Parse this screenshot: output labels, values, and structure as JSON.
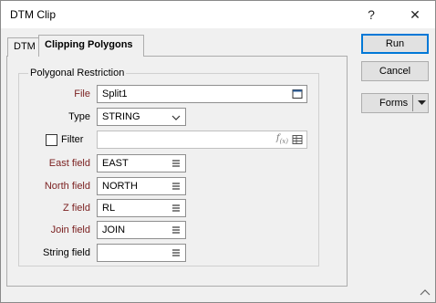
{
  "window": {
    "title": "DTM Clip",
    "help_glyph": "?",
    "close_glyph": "✕"
  },
  "tabs": [
    {
      "label": "DTM",
      "active": false
    },
    {
      "label": "Clipping Polygons",
      "active": true
    }
  ],
  "group": {
    "legend": "Polygonal Restriction"
  },
  "fields": {
    "file": {
      "label": "File",
      "value": "Split1"
    },
    "type": {
      "label": "Type",
      "value": "STRING"
    },
    "filter": {
      "label": "Filter",
      "checked": false,
      "value": ""
    },
    "east": {
      "label": "East field",
      "value": "EAST"
    },
    "north": {
      "label": "North field",
      "value": "NORTH"
    },
    "z": {
      "label": "Z field",
      "value": "RL"
    },
    "join": {
      "label": "Join field",
      "value": "JOIN"
    },
    "string": {
      "label": "String field",
      "value": ""
    }
  },
  "buttons": {
    "run": {
      "label": "Run"
    },
    "cancel": {
      "label": "Cancel"
    },
    "forms": {
      "label": "Forms"
    }
  },
  "colors": {
    "required_label": "#7a1f1f",
    "default_button_border": "#0078d7"
  }
}
